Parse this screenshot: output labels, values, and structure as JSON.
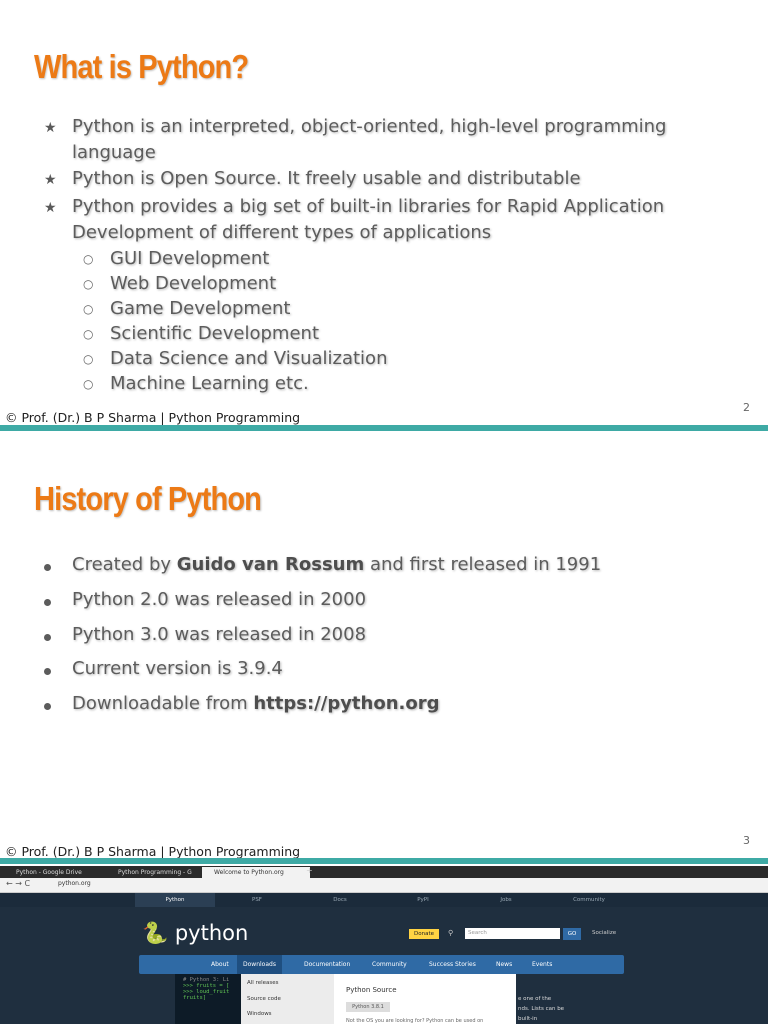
{
  "slide1": {
    "title": "What is Python?",
    "bullets": [
      {
        "line1": "Python is an interpreted, object-oriented, high-level programming",
        "line2": "language"
      },
      {
        "line1": "Python is Open Source. It freely usable and distributable"
      },
      {
        "line1": "Python provides a big set of built-in libraries for Rapid Application",
        "line2": "Development of different types of applications"
      }
    ],
    "subbullets": [
      "GUI Development",
      "Web Development",
      "Game Development",
      "Scientific Development",
      "Data Science and Visualization",
      "Machine Learning etc."
    ],
    "footer": "© Prof. (Dr.) B P Sharma | Python Programming",
    "page_number": "2",
    "bullet_glyph": "★",
    "sub_glyph": "○"
  },
  "slide2": {
    "title": "History of Python",
    "b1_pre": "Created by ",
    "b1_bold": "Guido van Rossum",
    "b1_post": " and first released in 1991",
    "b2": "Python 2.0 was released in 2000",
    "b3": "Python 3.0 was released in 2008",
    "b4": "Current version is 3.9.4",
    "b5_pre": "Downloadable from ",
    "b5_bold": "https://python.org",
    "footer": "© Prof. (Dr.) B P Sharma | Python Programming",
    "page_number": "3"
  },
  "slide3": {
    "tabs": [
      "Python - Google Drive",
      "Python Programming - G",
      "Welcome to Python.org"
    ],
    "url": "python.org",
    "topnav": [
      "Python",
      "PSF",
      "Docs",
      "PyPI",
      "Jobs",
      "Community"
    ],
    "logo": "python",
    "donate": "Donate",
    "search_placeholder": "Search",
    "go": "GO",
    "socialize": "Socialize",
    "menu": [
      "About",
      "Downloads",
      "Documentation",
      "Community",
      "Success Stories",
      "News",
      "Events"
    ],
    "dropdown": [
      "All releases",
      "Source code",
      "Windows"
    ],
    "popup_title": "Python Source",
    "popup_button": "Python 3.8.1",
    "popup_text": "Not the OS you are looking for? Python can be used on",
    "code_lines": [
      "# Python 3: Li",
      ">>> fruits = [",
      ">>> loud_fruit",
      "fruits]"
    ],
    "side_text": [
      "e one of the",
      "nds. Lists can be",
      "built-in"
    ],
    "colors": {
      "accent": "#ec7a16",
      "teal": "#3eaaa5",
      "python_blue": "#2f6aa5",
      "donate": "#ffd343"
    }
  }
}
